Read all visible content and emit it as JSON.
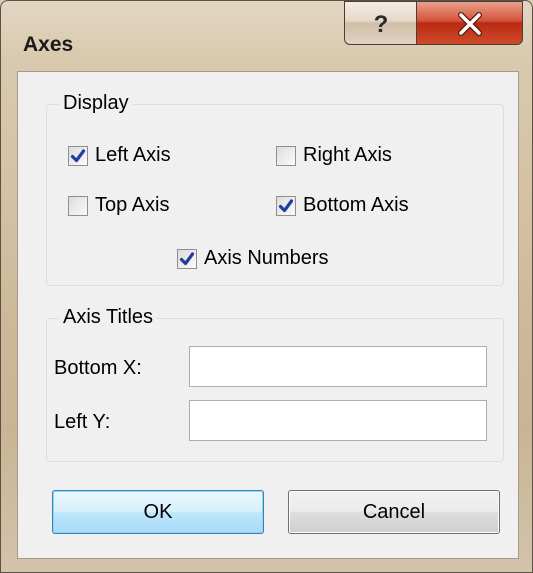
{
  "window": {
    "title": "Axes",
    "help_label": "?",
    "close_icon": "close-icon"
  },
  "display": {
    "legend": "Display",
    "left_axis": {
      "label": "Left Axis",
      "checked": true
    },
    "right_axis": {
      "label": "Right Axis",
      "checked": false
    },
    "top_axis": {
      "label": "Top Axis",
      "checked": false
    },
    "bottom_axis": {
      "label": "Bottom Axis",
      "checked": true
    },
    "axis_numbers": {
      "label": "Axis Numbers",
      "checked": true
    }
  },
  "axis_titles": {
    "legend": "Axis Titles",
    "bottom_x": {
      "label": "Bottom X:",
      "value": ""
    },
    "left_y": {
      "label": "Left Y:",
      "value": ""
    }
  },
  "buttons": {
    "ok": "OK",
    "cancel": "Cancel"
  },
  "colors": {
    "check_mark": "#1f3f9a",
    "close_button": "#c2381c",
    "ok_border": "#3c7fb1"
  }
}
